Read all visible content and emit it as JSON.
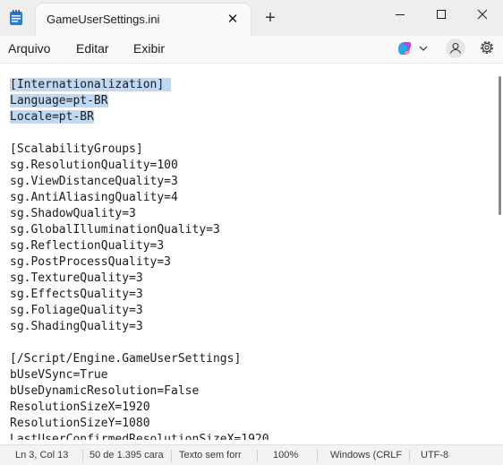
{
  "window": {
    "tab_title": "GameUserSettings.ini",
    "close_tab_glyph": "✕",
    "new_tab_glyph": "+"
  },
  "menu": {
    "items": [
      "Arquivo",
      "Editar",
      "Exibir"
    ]
  },
  "editor": {
    "selected_lines": 3,
    "lines": [
      "[Internationalization]",
      "Language=pt-BR",
      "Locale=pt-BR",
      "",
      "[ScalabilityGroups]",
      "sg.ResolutionQuality=100",
      "sg.ViewDistanceQuality=3",
      "sg.AntiAliasingQuality=4",
      "sg.ShadowQuality=3",
      "sg.GlobalIlluminationQuality=3",
      "sg.ReflectionQuality=3",
      "sg.PostProcessQuality=3",
      "sg.TextureQuality=3",
      "sg.EffectsQuality=3",
      "sg.FoliageQuality=3",
      "sg.ShadingQuality=3",
      "",
      "[/Script/Engine.GameUserSettings]",
      "bUseVSync=True",
      "bUseDynamicResolution=False",
      "ResolutionSizeX=1920",
      "ResolutionSizeY=1080",
      "LastUserConfirmedResolutionSizeX=1920"
    ]
  },
  "status": {
    "position": "Ln 3, Col 13",
    "chars": "50 de 1.395 cara",
    "format": "Texto sem forr",
    "zoom": "100%",
    "line_ending": "Windows (CRLF",
    "encoding": "UTF-8"
  },
  "icons": {
    "app": "notepad-icon",
    "copilot": "copilot-icon",
    "profile": "profile-icon",
    "settings": "gear-icon"
  },
  "colors": {
    "selection": "#bfd9f2",
    "titlebar": "#eeeeee"
  }
}
